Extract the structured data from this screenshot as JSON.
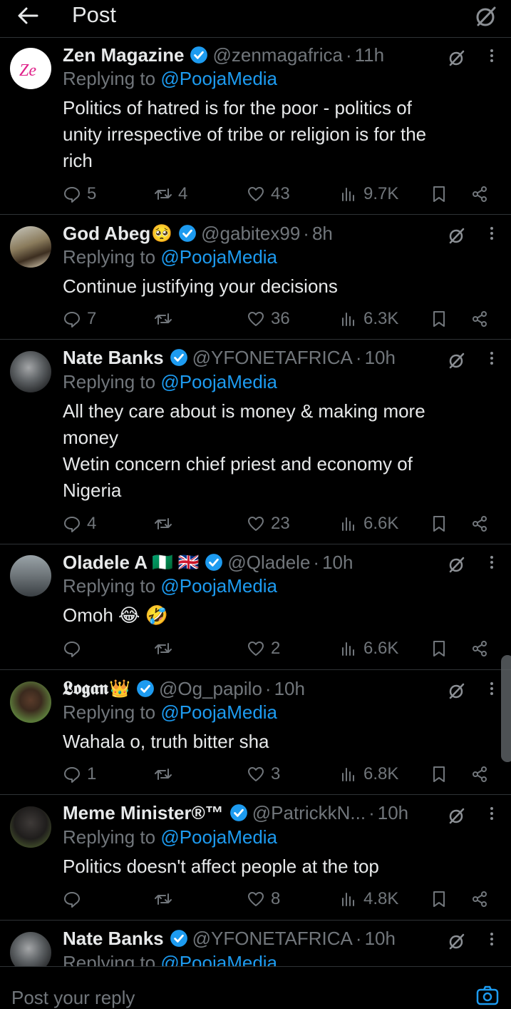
{
  "header": {
    "title": "Post"
  },
  "colors": {
    "accent": "#1d9bf0",
    "muted": "#71767b",
    "background": "#000000",
    "text": "#e7e9ea",
    "divider": "#2f3336"
  },
  "replies": [
    {
      "name": "Zen Magazine",
      "name_emoji": "",
      "handle": "@zenmagafrica",
      "time": "11h",
      "replying_label": "Replying to",
      "replying_to": "@PoojaMedia",
      "text": [
        "Politics of hatred is for the poor - politics of",
        "unity irrespective of tribe or religion is for the",
        "rich"
      ],
      "replies": "5",
      "reposts": "4",
      "likes": "43",
      "views": "9.7K",
      "avatar_text": "Ze"
    },
    {
      "name": "God Abeg",
      "name_emoji": "🥺",
      "handle": "@gabitex99",
      "time": "8h",
      "replying_label": "Replying to",
      "replying_to": "@PoojaMedia",
      "text": [
        "Continue justifying your decisions"
      ],
      "replies": "7",
      "reposts": "",
      "likes": "36",
      "views": "6.3K"
    },
    {
      "name": "Nate Banks",
      "name_emoji": "",
      "handle": "@YFONETAFRICA",
      "time": "10h",
      "replying_label": "Replying to",
      "replying_to": "@PoojaMedia",
      "text": [
        "All they care about is money & making more",
        "money",
        "Wetin concern chief priest and economy of",
        "Nigeria"
      ],
      "replies": "4",
      "reposts": "",
      "likes": "23",
      "views": "6.6K"
    },
    {
      "name": "Oladele A",
      "name_emoji": "🇳🇬 🇬🇧",
      "handle": "@Qladele",
      "time": "10h",
      "replying_label": "Replying to",
      "replying_to": "@PoojaMedia",
      "text": [
        "Omoh 😂 🤣"
      ],
      "replies": "",
      "reposts": "",
      "likes": "2",
      "views": "6.6K"
    },
    {
      "name": "𝕷𝖔𝖌𝖆𝖓",
      "name_emoji": "👑",
      "handle": "@Og_papilo",
      "time": "10h",
      "replying_label": "Replying to",
      "replying_to": "@PoojaMedia",
      "text": [
        "Wahala o, truth bitter sha"
      ],
      "replies": "1",
      "reposts": "",
      "likes": "3",
      "views": "6.8K"
    },
    {
      "name": "Meme Minister®™",
      "name_emoji": "",
      "handle": "@PatrickkN...",
      "time": "10h",
      "replying_label": "Replying to",
      "replying_to": "@PoojaMedia",
      "text": [
        "Politics doesn't affect people at the top"
      ],
      "replies": "",
      "reposts": "",
      "likes": "8",
      "views": "4.8K"
    },
    {
      "name": "Nate Banks",
      "name_emoji": "",
      "handle": "@YFONETAFRICA",
      "time": "10h",
      "replying_label": "Replying to",
      "replying_to": "@PoojaMedia",
      "text": [],
      "replies": "",
      "reposts": "",
      "likes": "",
      "views": ""
    }
  ],
  "composer": {
    "placeholder": "Post your reply"
  },
  "icons": [
    "back-arrow-icon",
    "grok-icon",
    "verified-icon",
    "more-icon",
    "reply-icon",
    "repost-icon",
    "like-icon",
    "views-icon",
    "bookmark-icon",
    "share-icon",
    "camera-icon"
  ]
}
